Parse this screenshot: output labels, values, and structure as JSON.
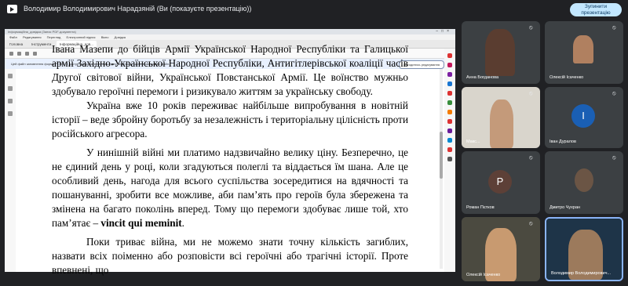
{
  "meeting": {
    "presenter_title": "Володимир Володимирович Нарадзяній (Ви (показуєте презентацію))",
    "stop_button": "Зупинити презентацію"
  },
  "shared_window": {
    "title": "Інформаційна_довідка (Запис PDF-документа)",
    "menu": [
      "Файл",
      "Редагування",
      "Перегляд",
      "Електронний підпис",
      "Вікно",
      "Довідка"
    ],
    "tabs": [
      "Головна",
      "Інструменти",
      "Інформаційна_дов..."
    ],
    "info_text": "Цей файл заповнення форми PDF/A. Її доступ представлений лише для перегляду, щоб не змінювати файл.",
    "info_button": "Погодитись редагування",
    "accent_color": "#2d6fd2"
  },
  "document": {
    "p1_lines": [
      "Івана Мазепи до бійців Армії Української Народної Республіки та Галицької армії",
      "Західно-Української Народної Республіки, Антигітлерівської коаліції часів Другої",
      "світової війни, Української Повстанської Армії. Це воїнство мужньо здобувало",
      "героїчні перемоги і ризикувало життям за українську свободу."
    ],
    "p2_lines": [
      "Україна вже 10 років переживає найбільше випробування в новітній історії",
      "– веде збройну боротьбу за незалежність і територіальну цілісність проти",
      "російського агресора."
    ],
    "p3_lines": [
      "У нинішній війні ми платимо надзвичайно велику ціну. Безперечно, це не",
      "єдиний день у році, коли згадуються полеглі та віддається їм шана. Але це",
      "особливий день, нагода для всього суспільства зосередитися на вдячності та",
      "пошануванні, зробити все можливе, аби пам’ять про героїв була збережена та",
      "змінена на багато поколінь вперед. Тому що перемоги здобуває лише той, хто"
    ],
    "p3_last_prefix": "пам’ятає – ",
    "p3_last_bold": "vincit qui meminit",
    "p3_last_suffix": ".",
    "p4_lines": [
      "Поки триває війна, ми не можемо знати точну кількість загиблих, назвати",
      "всіх поіменно або розповісти всі героїчні або трагічні історії. Проте впевнені, що"
    ]
  },
  "participants": [
    {
      "name": "Анна Богданова",
      "type": "video",
      "muted": true
    },
    {
      "name": "Олексій Ісаченко",
      "type": "video",
      "muted": true
    },
    {
      "name": "Макс...",
      "type": "video",
      "muted": true
    },
    {
      "name": "Іван Дуралов",
      "type": "avatar",
      "initial": "I",
      "color": "#1a5fb4",
      "muted": true
    },
    {
      "name": "Роман Пєтков",
      "type": "avatar",
      "initial": "P",
      "color": "#5d4037",
      "muted": true
    },
    {
      "name": "Дмитро Чухран",
      "type": "video",
      "muted": true
    },
    {
      "name": "Олексій Ісаченко",
      "type": "video",
      "muted": true
    },
    {
      "name": "Володимир Володимирович...",
      "type": "video",
      "muted": false,
      "active": true
    }
  ]
}
